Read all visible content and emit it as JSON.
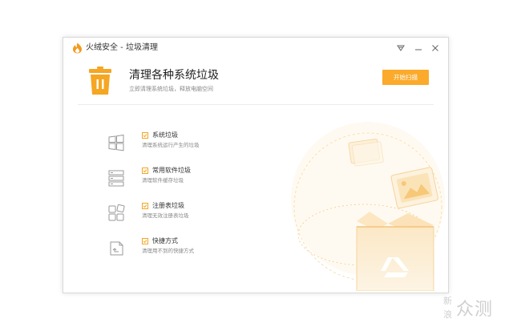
{
  "window": {
    "title": "火绒安全 - 垃圾清理"
  },
  "header": {
    "title": "清理各种系统垃圾",
    "subtitle": "立即清理系统垃圾，释放电脑空间",
    "start_button": "开始扫描"
  },
  "items": [
    {
      "label": "系统垃圾",
      "desc": "清理系统运行产生的垃圾",
      "checked": true,
      "icon": "windows-logo-icon"
    },
    {
      "label": "常用软件垃圾",
      "desc": "清理软件缓存垃圾",
      "checked": true,
      "icon": "stacked-storage-icon"
    },
    {
      "label": "注册表垃圾",
      "desc": "清理无效注册表垃圾",
      "checked": true,
      "icon": "registry-blocks-icon"
    },
    {
      "label": "快捷方式",
      "desc": "清理用不到的快捷方式",
      "checked": true,
      "icon": "shortcut-arrow-icon"
    }
  ],
  "watermark": {
    "line1": "新",
    "line2": "浪",
    "brand": "众测"
  },
  "colors": {
    "accent": "#fbaa2b",
    "checkbox_border": "#f5a623",
    "icon_gray": "#9a9a9a",
    "illustration_tint": "#f8dfb0"
  }
}
